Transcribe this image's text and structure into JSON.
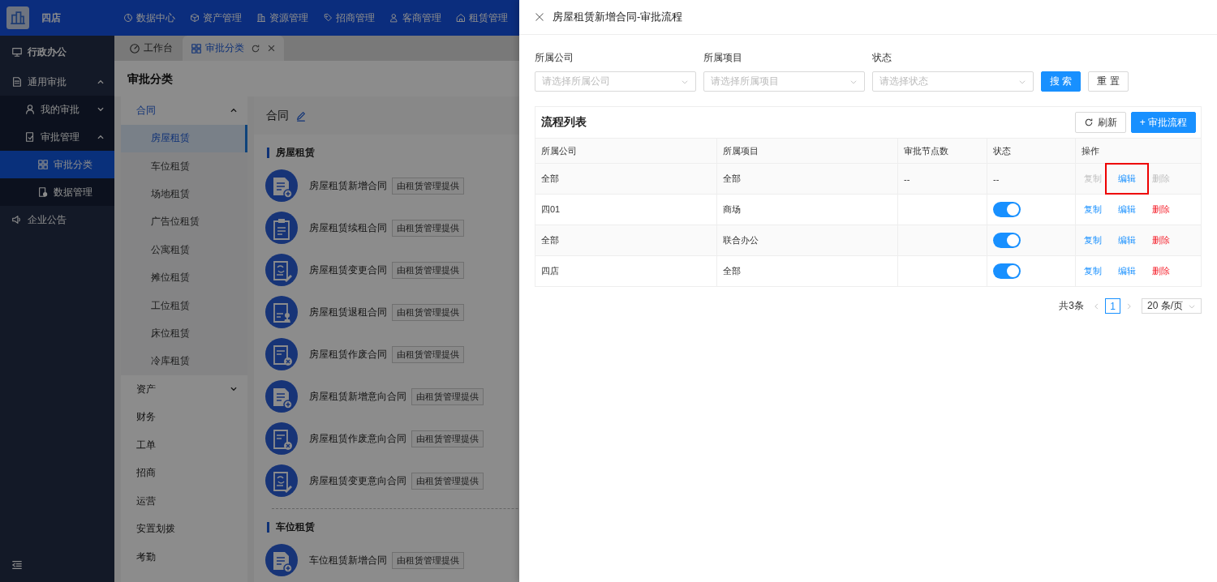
{
  "topbar": {
    "brand": "四店",
    "nav": [
      {
        "label": "数据中心",
        "kind": "chart"
      },
      {
        "label": "资产管理",
        "kind": "cube"
      },
      {
        "label": "资源管理",
        "kind": "building"
      },
      {
        "label": "招商管理",
        "kind": "tag"
      },
      {
        "label": "客商管理",
        "kind": "users"
      },
      {
        "label": "租赁管理",
        "kind": "house"
      }
    ]
  },
  "sidebar": {
    "items": [
      {
        "label": "行政办公",
        "kind": "monitor",
        "selected": false
      },
      {
        "label": "通用审批",
        "kind": "doc",
        "selected": false,
        "expanded": true,
        "children": [
          {
            "label": "我的审批",
            "kind": "user",
            "selected": false,
            "expanded": false
          },
          {
            "label": "审批管理",
            "kind": "approval",
            "selected": false,
            "expanded": true,
            "children": [
              {
                "label": "审批分类",
                "kind": "grid",
                "selected": true
              },
              {
                "label": "数据管理",
                "kind": "data",
                "selected": false
              }
            ]
          }
        ]
      },
      {
        "label": "企业公告",
        "kind": "speaker",
        "selected": false
      }
    ]
  },
  "tabs": [
    {
      "label": "工作台",
      "kind": "dashboard",
      "selected": false
    },
    {
      "label": "审批分类",
      "kind": "grid",
      "selected": true
    }
  ],
  "page_title": "审批分类",
  "category_menu": [
    {
      "label": "合同",
      "selected": true,
      "expanded": true,
      "children": [
        {
          "label": "房屋租赁",
          "selected": true
        },
        {
          "label": "车位租赁",
          "selected": false
        },
        {
          "label": "场地租赁",
          "selected": false
        },
        {
          "label": "广告位租赁",
          "selected": false
        },
        {
          "label": "公寓租赁",
          "selected": false
        },
        {
          "label": "摊位租赁",
          "selected": false
        },
        {
          "label": "工位租赁",
          "selected": false
        },
        {
          "label": "床位租赁",
          "selected": false
        },
        {
          "label": "冷库租赁",
          "selected": false
        }
      ]
    },
    {
      "label": "资产",
      "selected": false,
      "expanded": false
    },
    {
      "label": "财务",
      "selected": false
    },
    {
      "label": "工单",
      "selected": false
    },
    {
      "label": "招商",
      "selected": false
    },
    {
      "label": "运营",
      "selected": false
    },
    {
      "label": "安置划拨",
      "selected": false
    },
    {
      "label": "考勤",
      "selected": false
    }
  ],
  "content": {
    "title": "合同",
    "sections": [
      {
        "title": "房屋租赁",
        "items": [
          {
            "name": "房屋租赁新增合同",
            "tag": "由租赁管理提供",
            "kind": "add"
          },
          {
            "name": "房屋租赁续租合同",
            "tag": "由租赁管理提供",
            "kind": "renew"
          },
          {
            "name": "房屋租赁变更合同",
            "tag": "由租赁管理提供",
            "kind": "change"
          },
          {
            "name": "房屋租赁退租合同",
            "tag": "由租赁管理提供",
            "kind": "terminate"
          },
          {
            "name": "房屋租赁作废合同",
            "tag": "由租赁管理提供",
            "kind": "void"
          },
          {
            "name": "房屋租赁新增意向合同",
            "tag": "由租赁管理提供",
            "kind": "add"
          },
          {
            "name": "房屋租赁作废意向合同",
            "tag": "由租赁管理提供",
            "kind": "void"
          },
          {
            "name": "房屋租赁变更意向合同",
            "tag": "由租赁管理提供",
            "kind": "change"
          }
        ]
      },
      {
        "title": "车位租赁",
        "items": [
          {
            "name": "车位租赁新增合同",
            "tag": "由租赁管理提供",
            "kind": "add"
          }
        ]
      }
    ]
  },
  "drawer": {
    "title": "房屋租赁新增合同-审批流程",
    "filters": [
      {
        "label": "所属公司",
        "placeholder": "请选择所属公司"
      },
      {
        "label": "所属项目",
        "placeholder": "请选择所属项目"
      },
      {
        "label": "状态",
        "placeholder": "请选择状态"
      }
    ],
    "buttons": [
      {
        "label": "搜 索",
        "kind": "primary"
      },
      {
        "label": "重 置",
        "kind": "default"
      }
    ],
    "table": {
      "title": "流程列表",
      "actions": [
        {
          "label": "刷新",
          "kind": "refresh"
        },
        {
          "label": "+ 审批流程",
          "kind": "primary"
        }
      ],
      "columns": [
        "所属公司",
        "所属项目",
        "审批节点数",
        "状态",
        "操作"
      ],
      "rows": [
        {
          "company": "全部",
          "project": "全部",
          "nodes": "--",
          "status": {
            "kind": "text",
            "text": "--"
          },
          "ops": [
            {
              "label": "复制",
              "kind": "normal",
              "disabled": true,
              "highlighted": false
            },
            {
              "label": "编辑",
              "kind": "normal",
              "disabled": false,
              "highlighted": true
            },
            {
              "label": "删除",
              "kind": "danger",
              "disabled": true,
              "highlighted": false
            }
          ]
        },
        {
          "company": "四01",
          "project": "商场",
          "status": {
            "kind": "switch",
            "on": true
          },
          "ops": [
            {
              "label": "复制",
              "kind": "normal",
              "disabled": false,
              "highlighted": false
            },
            {
              "label": "编辑",
              "kind": "normal",
              "disabled": false,
              "highlighted": false
            },
            {
              "label": "删除",
              "kind": "danger",
              "disabled": false,
              "highlighted": false
            }
          ]
        },
        {
          "company": "全部",
          "project": "联合办公",
          "status": {
            "kind": "switch",
            "on": true
          },
          "ops": [
            {
              "label": "复制",
              "kind": "normal",
              "disabled": false,
              "highlighted": false
            },
            {
              "label": "编辑",
              "kind": "normal",
              "disabled": false,
              "highlighted": false
            },
            {
              "label": "删除",
              "kind": "danger",
              "disabled": false,
              "highlighted": false
            }
          ]
        },
        {
          "company": "四店",
          "project": "全部",
          "status": {
            "kind": "switch",
            "on": true
          },
          "ops": [
            {
              "label": "复制",
              "kind": "normal",
              "disabled": false,
              "highlighted": false
            },
            {
              "label": "编辑",
              "kind": "normal",
              "disabled": false,
              "highlighted": false
            },
            {
              "label": "删除",
              "kind": "danger",
              "disabled": false,
              "highlighted": false
            }
          ]
        }
      ]
    },
    "pagination": {
      "total": "共3条",
      "pages": [
        {
          "label": "1",
          "selected": true
        }
      ],
      "page_size": "20 条/页"
    }
  }
}
